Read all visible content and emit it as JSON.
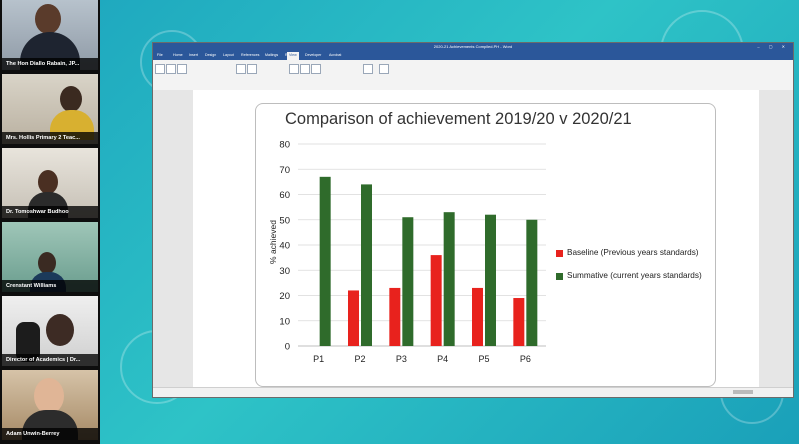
{
  "participants": [
    {
      "name": "The Hon Diallo Rabain, JP..."
    },
    {
      "name": "Mrs. Hollis Primary 2 Teac..."
    },
    {
      "name": "Dr. Tomoshwar Budhoo"
    },
    {
      "name": "Crenstant Williams"
    },
    {
      "name": "Director of Academics | Dr..."
    },
    {
      "name": "Adam Unwin-Berrey"
    }
  ],
  "word": {
    "document_title": "2020-21 Achievements Compiled.PH - Word",
    "tabs": [
      "File",
      "Home",
      "Insert",
      "Design",
      "Layout",
      "References",
      "Mailings",
      "Review",
      "View",
      "Developer",
      "Acrobat"
    ],
    "active_tab": "View"
  },
  "chart_data": {
    "type": "bar",
    "title": "Comparison of achievement 2019/20 v 2020/21",
    "xlabel": "",
    "ylabel": "% achieved",
    "categories": [
      "P1",
      "P2",
      "P3",
      "P4",
      "P5",
      "P6"
    ],
    "ylim": [
      0,
      80
    ],
    "yticks": [
      0,
      10,
      20,
      30,
      40,
      50,
      60,
      70,
      80
    ],
    "grid": true,
    "legend_position": "right",
    "series": [
      {
        "name": "Baseline (Previous years standards)",
        "color": "#e8221d",
        "values": [
          0,
          22,
          23,
          36,
          23,
          19
        ]
      },
      {
        "name": "Summative (current years standards)",
        "color": "#2f6b2b",
        "values": [
          67,
          64,
          51,
          53,
          52,
          50
        ]
      }
    ]
  }
}
